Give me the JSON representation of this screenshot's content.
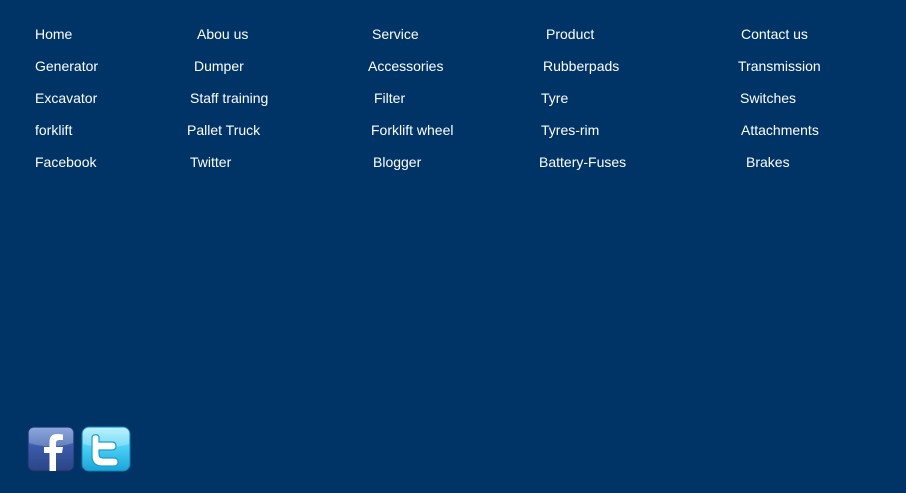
{
  "footer": {
    "rows": [
      [
        "Home",
        "Abou us",
        "Service",
        "Product",
        "Contact us"
      ],
      [
        "Generator",
        "Dumper",
        "Accessories",
        "Rubberpads",
        "Transmission"
      ],
      [
        "Excavator",
        "Staff training",
        "Filter",
        "Tyre",
        "Switches"
      ],
      [
        "forklift",
        "Pallet Truck",
        "Forklift wheel",
        "Tyres-rim",
        "Attachments"
      ],
      [
        "Facebook",
        "Twitter",
        "Blogger",
        "Battery-Fuses",
        "Brakes"
      ]
    ]
  },
  "social": {
    "facebook_icon": "facebook-icon",
    "twitter_icon": "twitter-icon"
  },
  "colors": {
    "background": "#003366",
    "link": "#ffffff",
    "facebook": "#3b5998",
    "twitter": "#33ccff"
  }
}
